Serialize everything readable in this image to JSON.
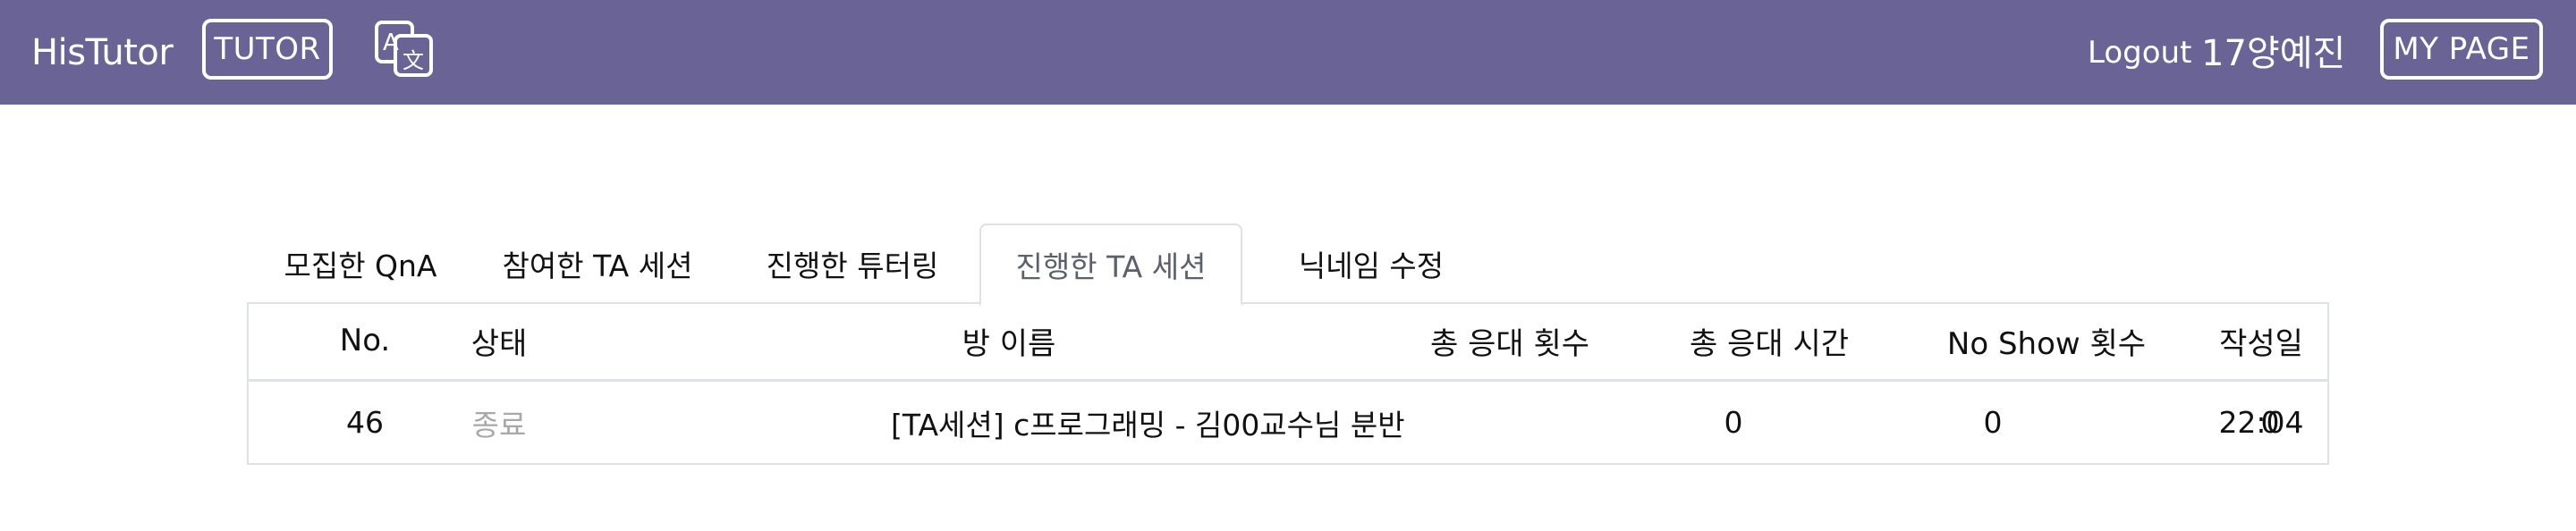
{
  "navbar": {
    "brand": "HisTutor",
    "tutor_label": "TUTOR",
    "translate_icon": "translate-icon",
    "logout_label": "Logout",
    "username": "17양예진",
    "mypage_label": "MY PAGE",
    "background_color": "#696396"
  },
  "tabs": [
    {
      "label": "모집한 QnA",
      "active": false
    },
    {
      "label": "참여한 TA 세션",
      "active": false
    },
    {
      "label": "진행한 튜터링",
      "active": false
    },
    {
      "label": "진행한 TA 세션",
      "active": true
    },
    {
      "label": "닉네임 수정",
      "active": false
    }
  ],
  "table": {
    "headers": [
      "No.",
      "상태",
      "방 이름",
      "총 응대 횟수",
      "총 응대 시간",
      "No Show 횟수",
      "작성일"
    ],
    "rows": [
      {
        "no": "46",
        "status": "종료",
        "room_name": "[TA세션] c프로그래밍 - 김00교수님 분반",
        "total_responses": "0",
        "total_time": "0",
        "no_show": "0",
        "created": "22:04"
      }
    ]
  }
}
